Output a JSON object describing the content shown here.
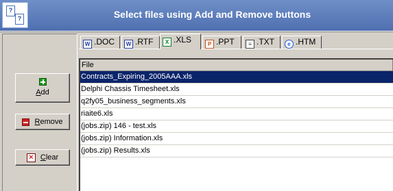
{
  "header": {
    "title": "Select files using Add and Remove buttons",
    "logo_glyph": "?"
  },
  "buttons": {
    "add_prefix": "",
    "add_underline": "A",
    "add_rest": "dd",
    "remove_prefix": "",
    "remove_underline": "R",
    "remove_rest": "emove",
    "clear_prefix": "",
    "clear_underline": "C",
    "clear_rest": "lear"
  },
  "tabs": [
    {
      "label": ".DOC",
      "icon": "word-doc-icon",
      "active": false
    },
    {
      "label": ".RTF",
      "icon": "word-rtf-icon",
      "active": false
    },
    {
      "label": ".XLS",
      "icon": "excel-icon",
      "active": true
    },
    {
      "label": ".PPT",
      "icon": "powerpoint-icon",
      "active": false
    },
    {
      "label": ".TXT",
      "icon": "text-file-icon",
      "active": false
    },
    {
      "label": ".HTM",
      "icon": "html-icon",
      "active": false
    }
  ],
  "list": {
    "column_header": "File",
    "rows": [
      {
        "name": "Contracts_Expiring_2005AAA.xls",
        "selected": true
      },
      {
        "name": "Delphi Chassis Timesheet.xls",
        "selected": false
      },
      {
        "name": "q2fy05_business_segments.xls",
        "selected": false
      },
      {
        "name": "riaite6.xls",
        "selected": false
      },
      {
        "name": "(jobs.zip) 146 - test.xls",
        "selected": false
      },
      {
        "name": "(jobs.zip) Information.xls",
        "selected": false
      },
      {
        "name": "(jobs.zip) Results.xls",
        "selected": false
      }
    ]
  },
  "colors": {
    "header_bg": "#5b7bbd",
    "selection_bg": "#0a246a",
    "window_bg": "#d4d0c8"
  }
}
